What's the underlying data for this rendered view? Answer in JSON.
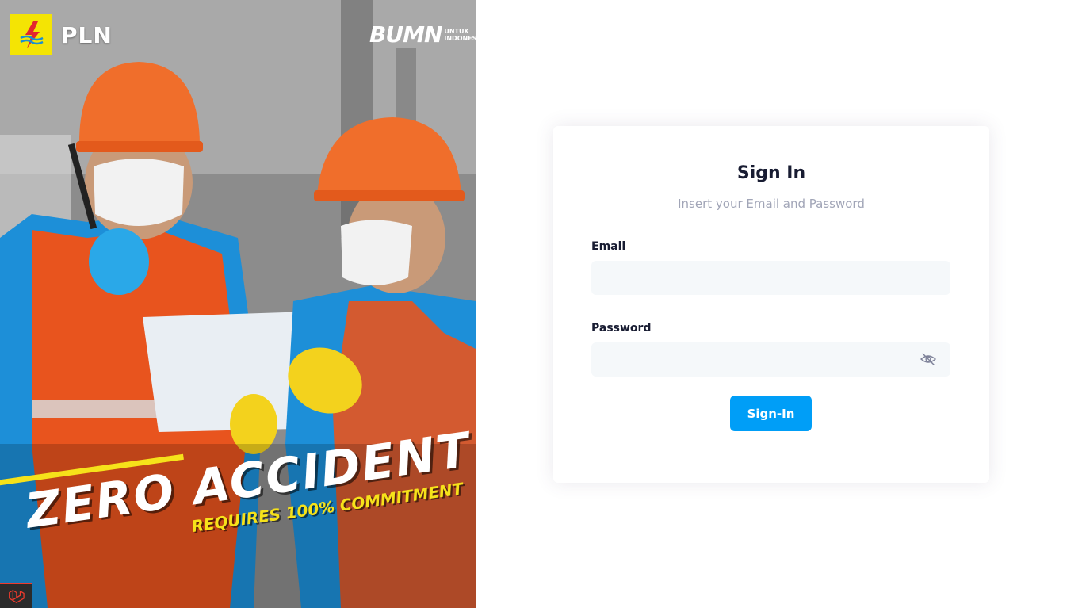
{
  "hero": {
    "brand_name": "PLN",
    "bumn_word": "BUMN",
    "bumn_tagline_line1": "UNTUK",
    "bumn_tagline_line2": "INDONESIA",
    "headline": "ZERO ACCIDENT",
    "subline": "REQUIRES 100% COMMITMENT",
    "colors": {
      "logo_yellow": "#f4e404",
      "accent_yellow": "#f6e21a",
      "vest_orange": "#e8541e",
      "jacket_blue": "#1d8fd8"
    }
  },
  "badge": {
    "icon": "laravel-icon"
  },
  "signin": {
    "title": "Sign In",
    "subtitle": "Insert your Email and Password",
    "email_label": "Email",
    "email_value": "",
    "password_label": "Password",
    "password_value": "",
    "password_toggle_icon": "eye-slash-icon",
    "submit_label": "Sign-In",
    "colors": {
      "primary": "#009ef7",
      "input_bg": "#f5f8fa",
      "title": "#181c32",
      "muted": "#a1a5b7"
    }
  }
}
